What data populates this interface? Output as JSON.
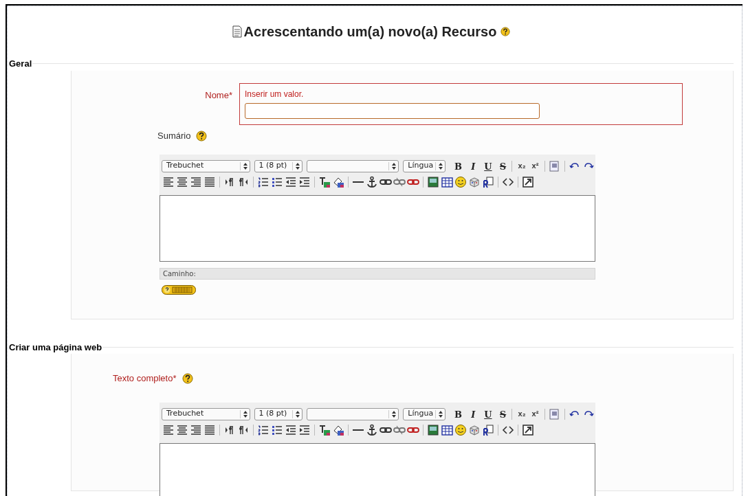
{
  "title": "Acrescentando um(a) novo(a) Recurso",
  "sections": [
    {
      "legend": "Geral",
      "fields": [
        {
          "kind": "text",
          "label": "Nome*",
          "required": true,
          "error": "Inserir um valor."
        },
        {
          "kind": "editor",
          "label": "Sumário",
          "required": false,
          "help": true,
          "editor": {
            "font": "Trebuchet",
            "size": "1 (8 pt)",
            "language": "Língua",
            "format_buttons": [
              "B",
              "I",
              "U",
              "S"
            ],
            "script_buttons": [
              "x₂",
              "x²"
            ],
            "path_label": "Caminho:",
            "keyboard_help": true
          }
        }
      ]
    },
    {
      "legend": "Criar uma página web",
      "fields": [
        {
          "kind": "editor",
          "label": "Texto completo*",
          "required": true,
          "help": true,
          "editor": {
            "font": "Trebuchet",
            "size": "1 (8 pt)",
            "language": "Língua",
            "format_buttons": [
              "B",
              "I",
              "U",
              "S"
            ],
            "script_buttons": [
              "x₂",
              "x²"
            ]
          }
        }
      ]
    }
  ]
}
